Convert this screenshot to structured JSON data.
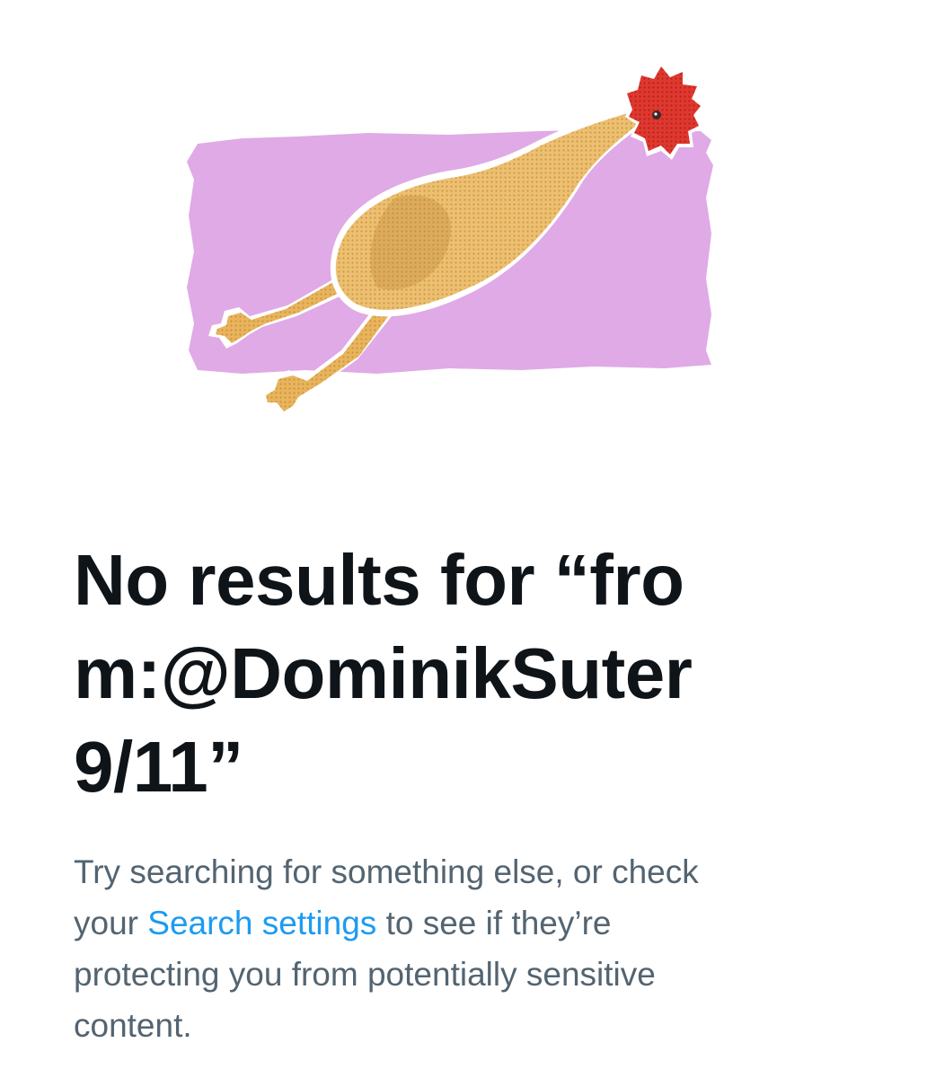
{
  "empty_state": {
    "title_lines": [
      "No results for “fro",
      "m:@DominikSuter",
      "9/11”"
    ],
    "message": {
      "line1": "Try searching for something else, or check",
      "line2_before": "your ",
      "link_label": "Search settings",
      "line2_after": " to see if they’re",
      "line3": "protecting you from potentially sensitive",
      "line4": "content."
    }
  },
  "colors": {
    "title": "#0f1419",
    "body": "#536471",
    "link": "#1d9bf0",
    "illustration_background": "#dfaae6",
    "chicken_body": "#e8b45c",
    "chicken_comb": "#e0382f"
  },
  "icons": {
    "illustration": "rubber-chicken-illustration"
  }
}
